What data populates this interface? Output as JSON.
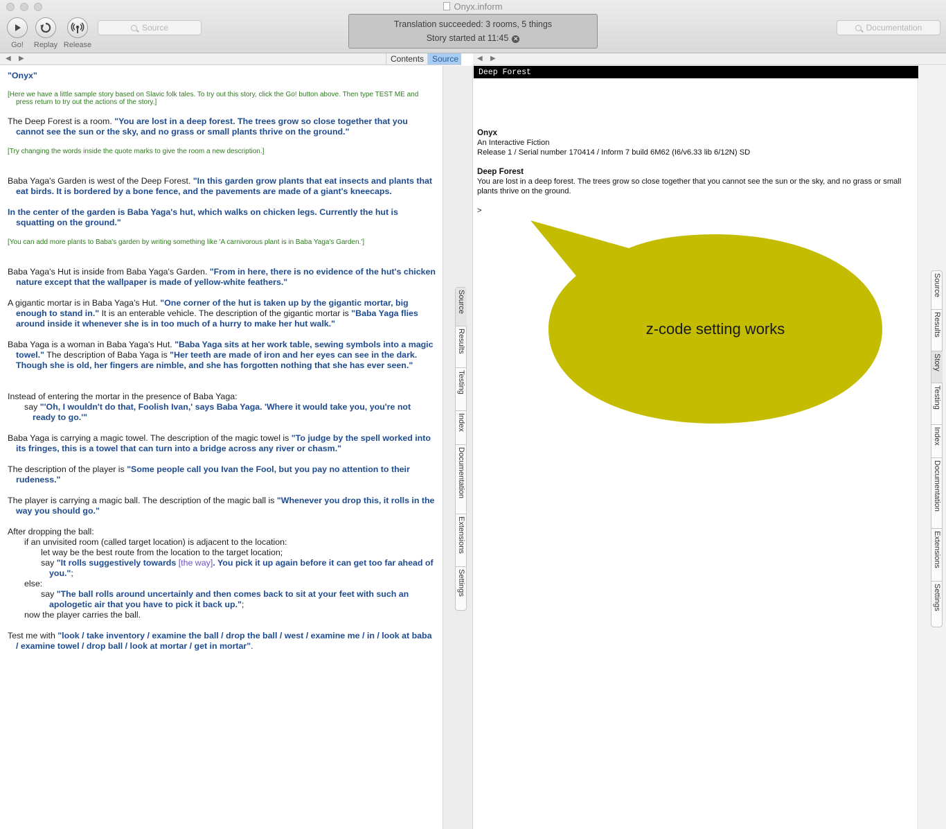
{
  "window": {
    "title": "Onyx.inform"
  },
  "toolbar": {
    "go_label": "Go!",
    "replay_label": "Replay",
    "release_label": "Release",
    "source_search_placeholder": "Source",
    "documentation_search_placeholder": "Documentation",
    "status_line1": "Translation succeeded: 3 rooms, 5 things",
    "status_line2": "Story started at 11:45"
  },
  "left_pane": {
    "tabs": [
      "Contents",
      "Source"
    ],
    "active_tab": "Source",
    "side_tabs": [
      "Source",
      "Results",
      "Testing",
      "Index",
      "Documentation",
      "Extensions",
      "Settings"
    ]
  },
  "source": {
    "title": "\"Onyx\"",
    "c1": "[Here we have a little sample story based on Slavic folk tales. To try out this story, click the Go! button above. Then type TEST ME and press return to try out the actions of the story.]",
    "p1a": "The Deep Forest is a room. ",
    "p1q": "\"You are lost in a deep forest. The trees grow so close together that you cannot see the sun or the sky, and no grass or small plants thrive on the ground.\"",
    "c2": "[Try changing the words inside the quote marks to give the room a new description.]",
    "p2a": "Baba Yaga's Garden is west of the Deep Forest. ",
    "p2q": "\"In this garden grow plants that eat insects and plants that eat birds. It is bordered by a bone fence, and the pavements are made of a giant's kneecaps.",
    "p2q2": "In the center of the garden is Baba Yaga's hut, which walks on chicken legs. Currently the hut is squatting on the ground.\"",
    "c3": "[You can add more plants to Baba's garden by writing something like 'A carnivorous plant is in Baba Yaga's Garden.']",
    "p3a": "Baba Yaga's Hut is inside from Baba Yaga's Garden. ",
    "p3q": "\"From in here, there is no evidence of the hut's chicken nature except that the wallpaper is made of yellow-white feathers.\"",
    "p4a": "A gigantic mortar is in Baba Yaga's Hut. ",
    "p4q": "\"One corner of the hut is taken up by the gigantic mortar, big enough to stand in.\"",
    "p4b": " It is an enterable vehicle. The description of the gigantic mortar is ",
    "p4q2": "\"Baba Yaga flies around inside it whenever she is in too much of a hurry to make her hut walk.\"",
    "p5a": "Baba Yaga is a woman in Baba Yaga's Hut. ",
    "p5q": "\"Baba Yaga sits at her work table, sewing symbols into a magic towel.\"",
    "p5b": " The description of Baba Yaga is ",
    "p5q2": "\"Her teeth are made of iron and her eyes can see in the dark. Though she is old, her fingers are nimble, and she has forgotten nothing that she has ever seen.\"",
    "p6a": "Instead of entering the mortar in the presence of Baba Yaga:",
    "p6b": "say ",
    "p6q": "\"'Oh, I wouldn't do that, Foolish Ivan,' says Baba Yaga. 'Where it would take you, you're not ready to go.'\"",
    "p7a": "Baba Yaga is carrying a magic towel. The description of the magic towel is ",
    "p7q": "\"To judge by the spell worked into its fringes, this is a towel that can turn into a bridge across any river or chasm.\"",
    "p8a": "The description of the player is ",
    "p8q": "\"Some people call you Ivan the Fool, but you pay no attention to their rudeness.\"",
    "p9a": "The player is carrying a magic ball. The description of the magic ball is ",
    "p9q": "\"Whenever you drop this, it rolls in the way you should go.\"",
    "p10a": "After dropping the ball:",
    "p10b": "if an unvisited room (called target location) is adjacent to the location:",
    "p10c": "let way be the best route from the location to the target location;",
    "p10d": "say ",
    "p10q1": "\"It rolls suggestively towards ",
    "p10sub": "[the way]",
    "p10q2": ". You pick it up again before it can get too far ahead of you.\"",
    "p10semi": ";",
    "p10e": "else:",
    "p10f": "say ",
    "p10q3": "\"The ball rolls around uncertainly and then comes back to sit at your feet with such an apologetic air that you have to pick it back up.\"",
    "p10semi2": ";",
    "p10g": "now the player carries the ball.",
    "p11a": "Test me with ",
    "p11q": "\"look / take inventory / examine the ball / drop the ball / west / examine me / in / look at baba / examine towel / drop ball / look at mortar / get in mortar\"",
    "p11end": "."
  },
  "right_pane": {
    "side_tabs": [
      "Source",
      "Results",
      "Story",
      "Testing",
      "Index",
      "Documentation",
      "Extensions",
      "Settings"
    ],
    "active_tab": "Story"
  },
  "story": {
    "status_bar": "Deep Forest",
    "game_title": "Onyx",
    "subtitle": "An Interactive Fiction",
    "release": "Release 1 / Serial number 170414 / Inform 7 build 6M62 (I6/v6.33 lib 6/12N) SD",
    "room": "Deep Forest",
    "description": "You are lost in a deep forest. The trees grow so close together that you cannot see the sun or the sky, and no grass or small plants thrive on the ground.",
    "prompt": ">"
  },
  "callout": {
    "text": "z-code setting works",
    "color": "#c4bc00"
  }
}
